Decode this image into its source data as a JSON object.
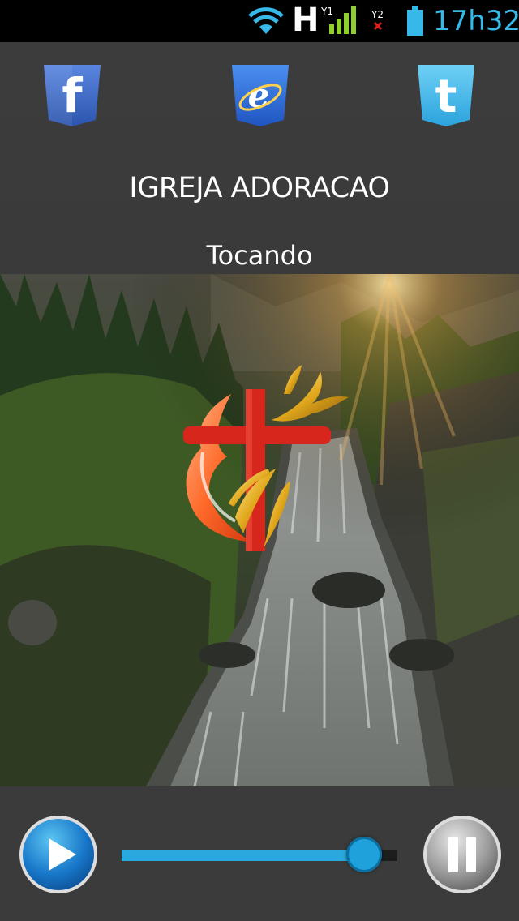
{
  "status_bar": {
    "network_type": "H",
    "time": "17h32",
    "icons": [
      "wifi-icon",
      "signal-sim1-icon",
      "signal-sim2-icon",
      "battery-icon"
    ]
  },
  "header": {
    "social": [
      {
        "name": "facebook",
        "icon": "facebook-icon",
        "color": "#3b66c4"
      },
      {
        "name": "website",
        "icon": "internet-explorer-icon",
        "color": "#2f6fd8"
      },
      {
        "name": "twitter",
        "icon": "twitter-icon",
        "color": "#35b4e6"
      }
    ],
    "title": "IGREJA ADORACAO",
    "status": "Tocando"
  },
  "artwork": {
    "logo": "cross-flame-dove-logo"
  },
  "player": {
    "play_icon": "play-icon",
    "pause_icon": "pause-icon",
    "volume": 0.88,
    "accent": "#29a9dd"
  }
}
